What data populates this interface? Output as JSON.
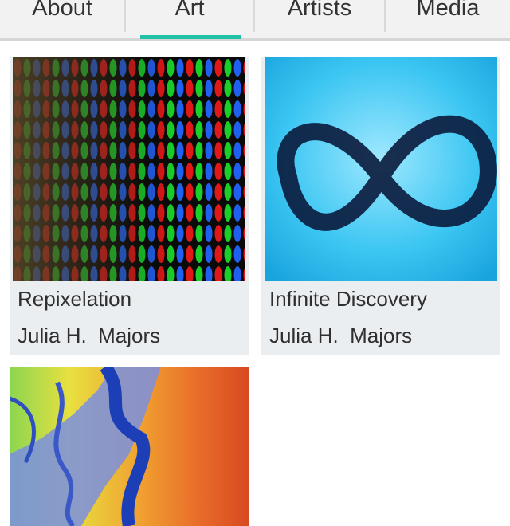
{
  "tabs": [
    {
      "label": "About"
    },
    {
      "label": "Art",
      "selected": true
    },
    {
      "label": "Artists"
    },
    {
      "label": "Media"
    }
  ],
  "accent_color": "#21c2a8",
  "artworks": [
    {
      "title": "Repixelation",
      "artist": "Julia H.  Majors"
    },
    {
      "title": "Infinite Discovery",
      "artist": "Julia H.  Majors"
    },
    {
      "title": "",
      "artist": ""
    }
  ]
}
